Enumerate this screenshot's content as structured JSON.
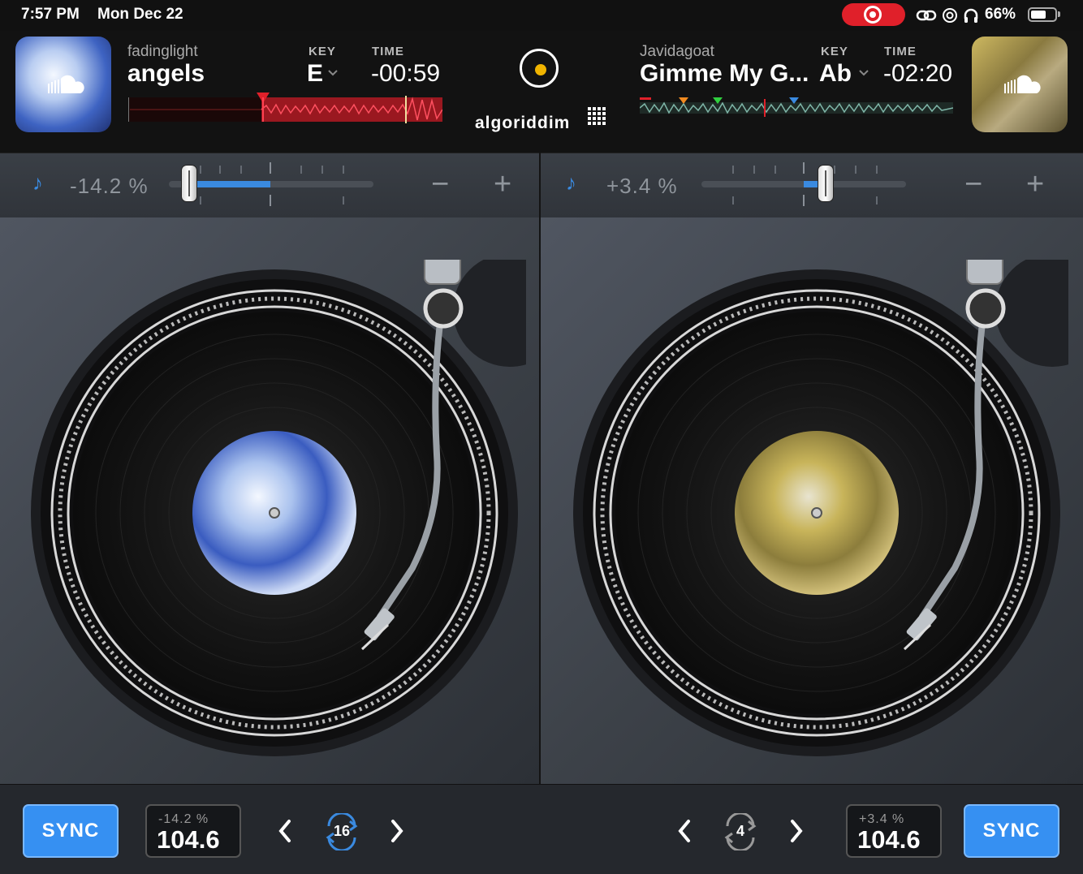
{
  "status_bar": {
    "time": "7:57 PM",
    "date": "Mon Dec 22",
    "battery_percent": "66%",
    "battery_level": 0.66,
    "icons": [
      "screen-record-icon",
      "link-icon",
      "at-icon",
      "headphones-icon",
      "battery-icon"
    ]
  },
  "colors": {
    "accent_blue": "#3690f2",
    "waveform_red": "#e0202a",
    "center_dot": "#f0b400"
  },
  "deck_a": {
    "artist": "fadinglight",
    "title": "angels",
    "key_label": "KEY",
    "key": "E",
    "time_label": "TIME",
    "time": "-00:59",
    "pitch": "-14.2 %",
    "pitch_bpm_pct": "-14.2 %",
    "bpm": "104.6",
    "sync_label": "SYNC",
    "loop_length": "16",
    "source_icon": "soundcloud-icon"
  },
  "deck_b": {
    "artist": "Javidagoat",
    "title": "Gimme My G...",
    "key_label": "KEY",
    "key": "Ab",
    "time_label": "TIME",
    "time": "-02:20",
    "pitch": "+3.4 %",
    "pitch_bpm_pct": "+3.4 %",
    "bpm": "104.6",
    "sync_label": "SYNC",
    "loop_length": "4",
    "source_icon": "soundcloud-icon"
  },
  "brand": "algoriddim",
  "controls": {
    "minus": "−",
    "plus": "+",
    "note_icon": "♪"
  }
}
